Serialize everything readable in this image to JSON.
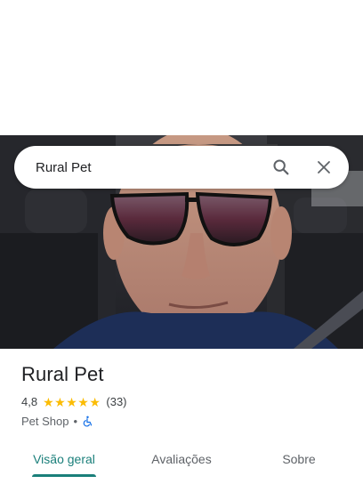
{
  "search": {
    "query": "Rural Pet"
  },
  "place": {
    "name": "Rural Pet",
    "rating": "4,8",
    "stars": 5,
    "review_count": "(33)",
    "category": "Pet Shop",
    "separator": "•"
  },
  "tabs": [
    {
      "label": "Visão geral",
      "active": true
    },
    {
      "label": "Avaliações",
      "active": false
    },
    {
      "label": "Sobre",
      "active": false
    }
  ],
  "colors": {
    "accent": "#1a7f7a",
    "star": "#fbbc04",
    "accessibility": "#1a73e8"
  },
  "icons": {
    "search": "search-icon",
    "close": "close-icon",
    "accessibility": "wheelchair-icon"
  }
}
